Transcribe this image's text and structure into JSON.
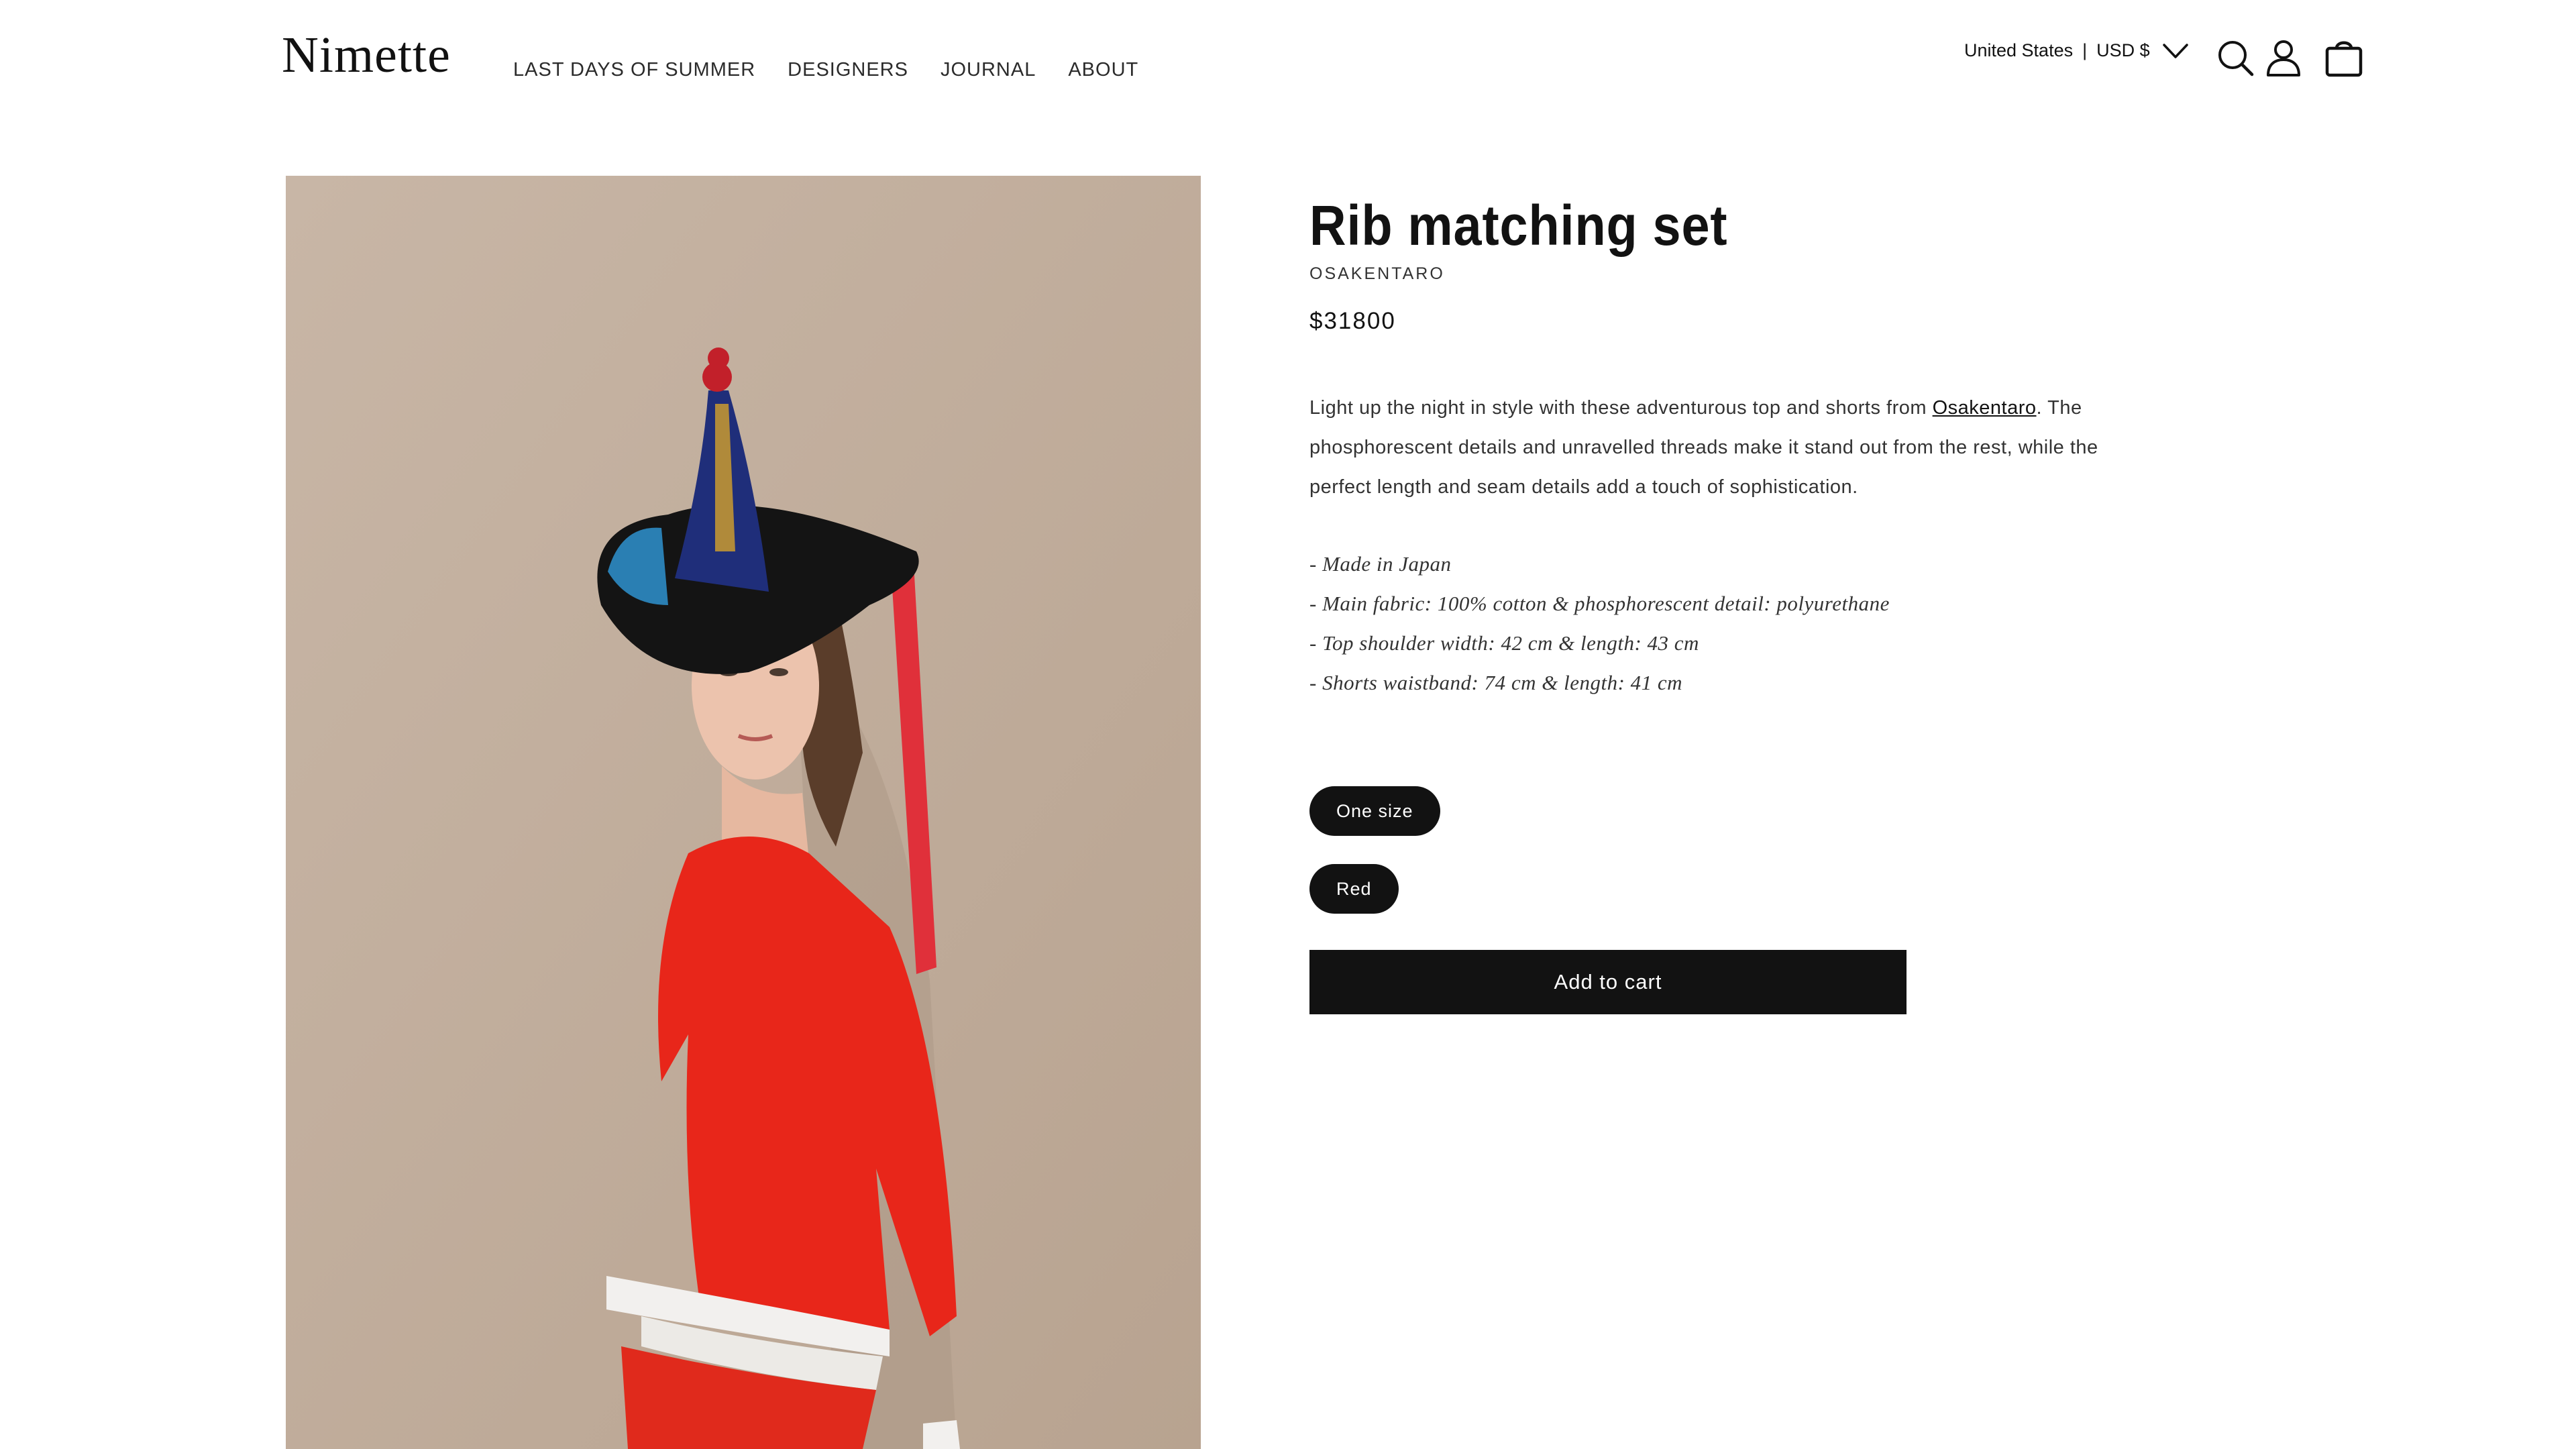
{
  "header": {
    "logo": "Nimette",
    "nav": [
      {
        "label": "LAST DAYS OF SUMMER"
      },
      {
        "label": "DESIGNERS"
      },
      {
        "label": "JOURNAL"
      },
      {
        "label": "ABOUT"
      }
    ],
    "locale": {
      "country": "United States",
      "separator": "|",
      "currency": "USD $"
    },
    "icons": [
      "chevron-down-icon",
      "search-icon",
      "account-icon",
      "cart-icon"
    ]
  },
  "product": {
    "image_icon": "product-photo",
    "title": "Rib matching set",
    "vendor": "OSAKENTARO",
    "price": "$31800",
    "description": {
      "before_link": "Light up the night in style with these adventurous top and shorts from ",
      "link_text": "Osakentaro",
      "after_link": ". The phosphorescent details and unravelled threads make it stand out from the rest, while the perfect length and seam details add a touch of sophistication."
    },
    "details": [
      "- Made in Japan",
      "- Main fabric: 100% cotton & phosphorescent detail: polyurethane",
      "- Top shoulder width: 42 cm & length: 43 cm",
      "- Shorts waistband: 74 cm & length: 41 cm"
    ],
    "size_option": "One size",
    "color_option": "Red",
    "add_to_cart": "Add to cart"
  },
  "colors": {
    "primary": "#121212",
    "background": "#ffffff",
    "photo_backdrop": "#c6b3a3",
    "garment": "#e8261a"
  }
}
